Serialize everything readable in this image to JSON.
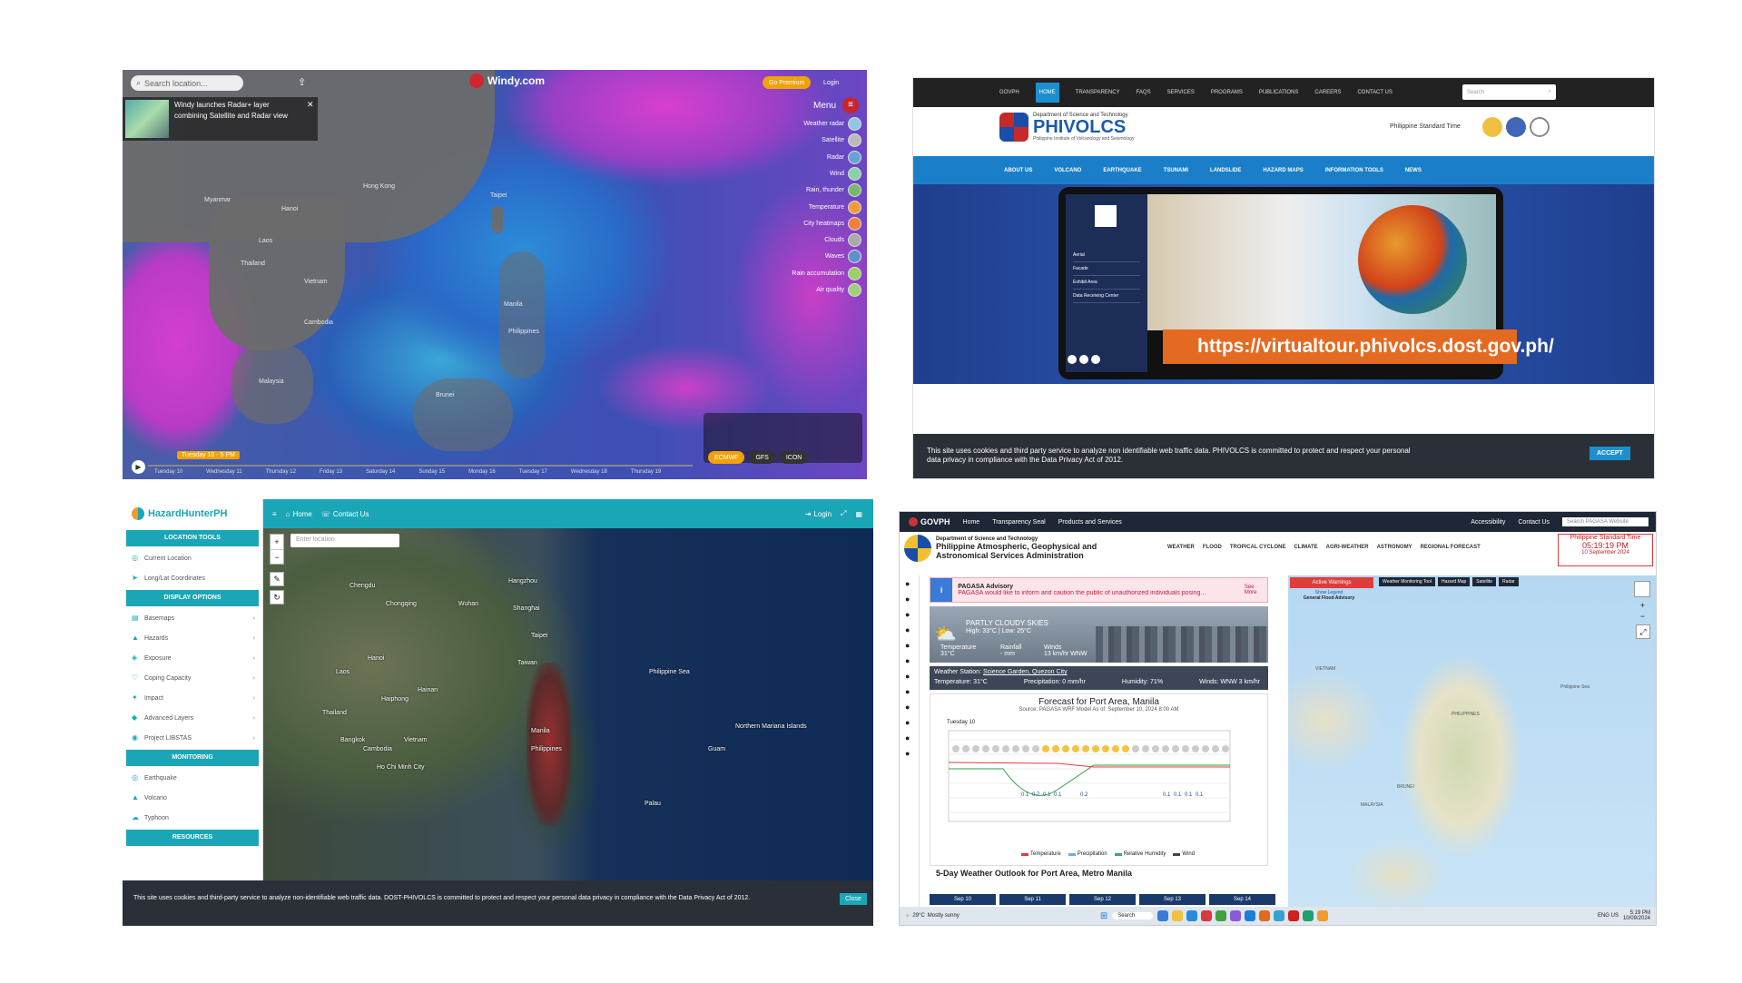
{
  "windy": {
    "search_placeholder": "Search location...",
    "logo": "Windy.com",
    "premium": "Go Premium",
    "login": "Login",
    "menu": "Menu",
    "news_text": "Windy launches Radar+ layer combining Satellite and Radar view",
    "layers": [
      "Weather radar",
      "Satellite",
      "Radar",
      "Wind",
      "Rain, thunder",
      "Temperature",
      "City heatmaps",
      "Clouds",
      "Waves",
      "Rain accumulation",
      "Air quality"
    ],
    "timeline_label": "Tuesday 10 - 5 PM",
    "days": [
      "Tuesday 10",
      "Wednesday 11",
      "Thursday 12",
      "Friday 13",
      "Saturday 14",
      "Sunday 15",
      "Monday 16",
      "Tuesday 17",
      "Wednesday 18",
      "Thursday 19"
    ],
    "model_buttons": [
      "ECMWF",
      "GFS",
      "ICON"
    ],
    "places": [
      "Myanmar",
      "Laos",
      "Thailand",
      "Vietnam",
      "Hanoi",
      "Hong Kong",
      "Taipei",
      "Manila",
      "Philippines",
      "Brunei",
      "Cambodia",
      "Malaysia"
    ],
    "colors": {
      "pink": "#d43fd0",
      "blue": "#2a6ac9",
      "premium": "#f0a20b",
      "timeline": "#f0a20b"
    }
  },
  "phivolcs": {
    "topnav": [
      "GOVPH",
      "HOME",
      "TRANSPARENCY",
      "FAQS",
      "SERVICES",
      "PROGRAMS",
      "PUBLICATIONS",
      "CAREERS",
      "CONTACT US"
    ],
    "search_placeholder": "Search",
    "org_full": "Department of Science and Technology",
    "org_name": "PHIVOLCS",
    "org_sub": "Philippine Institute of Volcanology and Seismology",
    "pst_label": "Philippine Standard Time",
    "mainnav": [
      "ABOUT US",
      "VOLCANO",
      "EARTHQUAKE",
      "TSUNAMI",
      "LANDSLIDE",
      "HAZARD MAPS",
      "INFORMATION TOOLS",
      "NEWS"
    ],
    "tour_menu": [
      "Aerial",
      "Facade",
      "Exhibit Area",
      "Data Receiving Center"
    ],
    "tour_url": "https://virtualtour.phivolcs.dost.gov.ph/",
    "cookie_text": "This site uses cookies and third party service to analyze non identifiable web traffic data. PHIVOLCS is committed to protect and respect your personal data privacy in compliance with the Data Privacy Act of 2012.",
    "accept": "ACCEPT",
    "colors": {
      "nav": "#1a7fc8",
      "url_banner": "#e46a22"
    }
  },
  "hazard": {
    "logo": "HazardHunterPH",
    "nav_home": "Home",
    "nav_contact": "Contact Us",
    "nav_login": "Login",
    "search_placeholder": "Enter location",
    "sections": {
      "location": "LOCATION TOOLS",
      "display": "DISPLAY OPTIONS",
      "monitoring": "MONITORING",
      "resources": "RESOURCES"
    },
    "location_items": [
      "Current Location",
      "Long/Lat Coordinates"
    ],
    "display_items": [
      "Basemaps",
      "Hazards",
      "Exposure",
      "Coping Capacity",
      "Impact",
      "Advanced Layers",
      "Project LIBSTAS"
    ],
    "monitoring_items": [
      "Earthquake",
      "Volcano",
      "Typhoon"
    ],
    "map_labels": [
      "Chengdu",
      "Chongqing",
      "Wuhan",
      "Hangzhou",
      "Shanghai",
      "Taipei",
      "Taiwan",
      "Hanoi",
      "Laos",
      "Thailand",
      "Vietnam",
      "Cambodia",
      "Manila",
      "Philippines",
      "Philippine Sea",
      "Northern Mariana Islands",
      "Guam",
      "Palau",
      "Haiphong",
      "Bangkok",
      "Ho Chi Minh City",
      "Hainan"
    ],
    "cookie_text": "This site uses cookies and third-party service to analyze non-identifiable web traffic data. DOST-PHIVOLCS is committed to protect and respect your personal data privacy in compliance with the Data Privacy Act of 2012.",
    "close": "Close",
    "colors": {
      "teal": "#1aa6b7"
    }
  },
  "pagasa": {
    "govph": "GOVPH",
    "topnav": [
      "Home",
      "Transparency Seal",
      "Products and Services"
    ],
    "top_right": [
      "Accessibility",
      "Contact Us"
    ],
    "search_placeholder": "Search PAGASA Website",
    "org_dept": "Department of Science and Technology",
    "org_name1": "Philippine Atmospheric, Geophysical and",
    "org_name2": "Astronomical Services Administration",
    "nav": [
      "WEATHER",
      "FLOOD",
      "TROPICAL CYCLONE",
      "CLIMATE",
      "AGRI-WEATHER",
      "ASTRONOMY",
      "REGIONAL FORECAST"
    ],
    "pst_label": "Philippine Standard Time",
    "pst_time": "05:19:19 PM",
    "pst_date": "10 September 2024",
    "advisory_title": "PAGASA Advisory",
    "advisory_text": "PAGASA would like to inform and caution the public of unauthorized individuals posing...",
    "see_more": "See More",
    "sky": "PARTLY CLOUDY SKIES",
    "high_low": "High: 33°C | Low: 25°C",
    "temp_label": "Temperature",
    "temp_val": "31°C",
    "rain_label": "Rainfall",
    "rain_val": "- mm",
    "wind_label": "Winds",
    "wind_val": "13 km/hr WNW",
    "station_label": "Weather Station:",
    "station": "Science Garden, Quezon City",
    "station_temp": "Temperature: 31°C",
    "station_precip": "Precipitation: 0 mm/hr",
    "station_hum": "Humidity: 71%",
    "station_wind": "Winds: WNW 3 km/hr",
    "forecast_title": "Forecast for Port Area, Manila",
    "forecast_sub": "Source: PAGASA WRF Model   As of: September 10, 2024 8:00 AM",
    "chart_day": "Tuesday 10",
    "rain_values": [
      "0.1",
      "0.7",
      "0.1",
      "0.1",
      "0.2",
      "0.1",
      "0.1",
      "0.1",
      "0.1"
    ],
    "legend": [
      "Temperature",
      "Precipitation",
      "Relative Humidity",
      "Wind"
    ],
    "outlook_title": "5-Day Weather Outlook for Port Area, Metro Manila",
    "outlook_days": [
      "Sep 10",
      "Sep 11",
      "Sep 12",
      "Sep 13",
      "Sep 14"
    ],
    "active_warnings": "Active Warnings",
    "show_legend": "Show Legend",
    "flood_advisory": "General Flood Advisory",
    "map_tabs": [
      "Weather Monitoring Tool",
      "Hazard Map",
      "Satellite",
      "Radar"
    ],
    "map_labels": [
      "PHILIPPINES",
      "VIETNAM",
      "MALAYSIA",
      "BRUNEI",
      "Philippine Sea"
    ],
    "taskbar": {
      "weather_temp": "29°C",
      "weather_text": "Mostly sunny",
      "search": "Search",
      "lang": "ENG US",
      "time": "5:19 PM",
      "date": "10/09/2024"
    },
    "colors": {
      "header": "#1d2735",
      "warning": "#e03b3b",
      "day_btn": "#1a3a6b"
    }
  }
}
